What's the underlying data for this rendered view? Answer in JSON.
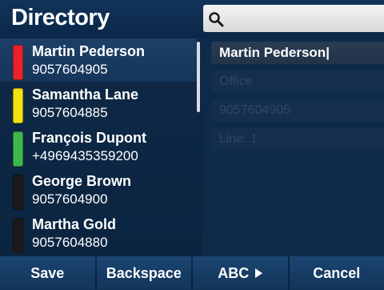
{
  "header": {
    "title": "Directory",
    "search_placeholder": ""
  },
  "contacts": [
    {
      "name": "Martin Pederson",
      "number": "9057604905",
      "status_color": "#e8232a",
      "selected": true
    },
    {
      "name": "Samantha Lane",
      "number": "9057604885",
      "status_color": "#f1e20e",
      "selected": false
    },
    {
      "name": "François Dupont",
      "number": "+4969435359200",
      "status_color": "#3fb84a",
      "selected": false
    },
    {
      "name": "George Brown",
      "number": "9057604900",
      "status_color": "#1a1a1a",
      "selected": false
    },
    {
      "name": "Martha Gold",
      "number": "9057604880",
      "status_color": "#1a1a1a",
      "selected": false
    }
  ],
  "detail": {
    "name_value": "Martin Pederson|",
    "label_value": "Office",
    "number_value": "9057604905",
    "line_value": "Line: 1"
  },
  "softkeys": {
    "save": "Save",
    "backspace": "Backspace",
    "abc": "ABC",
    "cancel": "Cancel"
  },
  "icons": {
    "search": "search-icon",
    "arrow": "play-arrow-icon"
  },
  "colors": {
    "background": "#0f2a47",
    "softkey_bar": "#1b4572",
    "selected_row": "#1d3f66"
  }
}
